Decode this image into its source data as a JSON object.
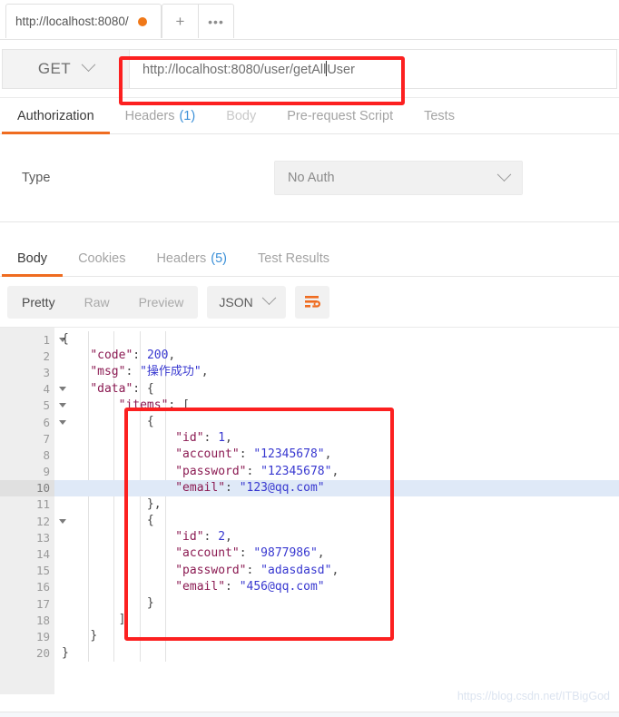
{
  "tabstrip": {
    "request_tab_title": "http://localhost:8080/",
    "unsaved_dot": "unsaved-dot",
    "new_tab_label": "+",
    "more_label": "•••"
  },
  "url_row": {
    "method": "GET",
    "url_before_caret": "http://localhost:8080/user/getAll",
    "url_after_caret": "User",
    "full_url": "http://localhost:8080/user/getAllUser"
  },
  "request_tabs": [
    {
      "label": "Authorization",
      "count": "",
      "active": true,
      "dim": false
    },
    {
      "label": "Headers",
      "count": "(1)",
      "active": false,
      "dim": false
    },
    {
      "label": "Body",
      "count": "",
      "active": false,
      "dim": true
    },
    {
      "label": "Pre-request Script",
      "count": "",
      "active": false,
      "dim": false
    },
    {
      "label": "Tests",
      "count": "",
      "active": false,
      "dim": false
    }
  ],
  "authorization": {
    "type_label": "Type",
    "selected_type": "No Auth"
  },
  "response_tabs": [
    {
      "label": "Body",
      "count": "",
      "active": true,
      "dim": false
    },
    {
      "label": "Cookies",
      "count": "",
      "active": false,
      "dim": false
    },
    {
      "label": "Headers",
      "count": "(5)",
      "active": false,
      "dim": false
    },
    {
      "label": "Test Results",
      "count": "",
      "active": false,
      "dim": false
    }
  ],
  "format_bar": {
    "views": [
      {
        "label": "Pretty",
        "active": true
      },
      {
        "label": "Raw",
        "active": false
      },
      {
        "label": "Preview",
        "active": false
      }
    ],
    "language": "JSON",
    "wrap_icon": "wrap-text-icon"
  },
  "response_body": {
    "highlighted_line": 10,
    "lines": [
      {
        "num": 1,
        "fold": true,
        "indent": 0,
        "tokens": [
          {
            "t": "p",
            "v": "{"
          }
        ]
      },
      {
        "num": 2,
        "fold": false,
        "indent": 1,
        "tokens": [
          {
            "t": "k",
            "v": "\"code\""
          },
          {
            "t": "p",
            "v": ": "
          },
          {
            "t": "n",
            "v": "200"
          },
          {
            "t": "p",
            "v": ","
          }
        ]
      },
      {
        "num": 3,
        "fold": false,
        "indent": 1,
        "tokens": [
          {
            "t": "k",
            "v": "\"msg\""
          },
          {
            "t": "p",
            "v": ": "
          },
          {
            "t": "s",
            "v": "\"操作成功\""
          },
          {
            "t": "p",
            "v": ","
          }
        ]
      },
      {
        "num": 4,
        "fold": true,
        "indent": 1,
        "tokens": [
          {
            "t": "k",
            "v": "\"data\""
          },
          {
            "t": "p",
            "v": ": {"
          }
        ]
      },
      {
        "num": 5,
        "fold": true,
        "indent": 2,
        "tokens": [
          {
            "t": "k",
            "v": "\"items\""
          },
          {
            "t": "p",
            "v": ": ["
          }
        ]
      },
      {
        "num": 6,
        "fold": true,
        "indent": 3,
        "tokens": [
          {
            "t": "p",
            "v": "{"
          }
        ]
      },
      {
        "num": 7,
        "fold": false,
        "indent": 4,
        "tokens": [
          {
            "t": "k",
            "v": "\"id\""
          },
          {
            "t": "p",
            "v": ": "
          },
          {
            "t": "n",
            "v": "1"
          },
          {
            "t": "p",
            "v": ","
          }
        ]
      },
      {
        "num": 8,
        "fold": false,
        "indent": 4,
        "tokens": [
          {
            "t": "k",
            "v": "\"account\""
          },
          {
            "t": "p",
            "v": ": "
          },
          {
            "t": "s",
            "v": "\"12345678\""
          },
          {
            "t": "p",
            "v": ","
          }
        ]
      },
      {
        "num": 9,
        "fold": false,
        "indent": 4,
        "tokens": [
          {
            "t": "k",
            "v": "\"password\""
          },
          {
            "t": "p",
            "v": ": "
          },
          {
            "t": "s",
            "v": "\"12345678\""
          },
          {
            "t": "p",
            "v": ","
          }
        ]
      },
      {
        "num": 10,
        "fold": false,
        "indent": 4,
        "tokens": [
          {
            "t": "k",
            "v": "\"email\""
          },
          {
            "t": "p",
            "v": ": "
          },
          {
            "t": "s",
            "v": "\"123@qq.com\""
          }
        ]
      },
      {
        "num": 11,
        "fold": false,
        "indent": 3,
        "tokens": [
          {
            "t": "p",
            "v": "},"
          }
        ]
      },
      {
        "num": 12,
        "fold": true,
        "indent": 3,
        "tokens": [
          {
            "t": "p",
            "v": "{"
          }
        ]
      },
      {
        "num": 13,
        "fold": false,
        "indent": 4,
        "tokens": [
          {
            "t": "k",
            "v": "\"id\""
          },
          {
            "t": "p",
            "v": ": "
          },
          {
            "t": "n",
            "v": "2"
          },
          {
            "t": "p",
            "v": ","
          }
        ]
      },
      {
        "num": 14,
        "fold": false,
        "indent": 4,
        "tokens": [
          {
            "t": "k",
            "v": "\"account\""
          },
          {
            "t": "p",
            "v": ": "
          },
          {
            "t": "s",
            "v": "\"9877986\""
          },
          {
            "t": "p",
            "v": ","
          }
        ]
      },
      {
        "num": 15,
        "fold": false,
        "indent": 4,
        "tokens": [
          {
            "t": "k",
            "v": "\"password\""
          },
          {
            "t": "p",
            "v": ": "
          },
          {
            "t": "s",
            "v": "\"adasdasd\""
          },
          {
            "t": "p",
            "v": ","
          }
        ]
      },
      {
        "num": 16,
        "fold": false,
        "indent": 4,
        "tokens": [
          {
            "t": "k",
            "v": "\"email\""
          },
          {
            "t": "p",
            "v": ": "
          },
          {
            "t": "s",
            "v": "\"456@qq.com\""
          }
        ]
      },
      {
        "num": 17,
        "fold": false,
        "indent": 3,
        "tokens": [
          {
            "t": "p",
            "v": "}"
          }
        ]
      },
      {
        "num": 18,
        "fold": false,
        "indent": 2,
        "tokens": [
          {
            "t": "p",
            "v": "]"
          }
        ]
      },
      {
        "num": 19,
        "fold": false,
        "indent": 1,
        "tokens": [
          {
            "t": "p",
            "v": "}"
          }
        ]
      },
      {
        "num": 20,
        "fold": false,
        "indent": 0,
        "tokens": [
          {
            "t": "p",
            "v": "}"
          }
        ]
      }
    ]
  },
  "annotations": [
    {
      "name": "url-highlight-box",
      "color": "#fc2020"
    },
    {
      "name": "json-items-highlight-box",
      "color": "#fc2020"
    }
  ],
  "watermark": "https://blog.csdn.net/ITBigGod",
  "colors": {
    "accent_orange": "#ef6c20",
    "unsaved_dot": "#f07818",
    "annotation_red": "#fc2020",
    "json_key": "#8b1a52",
    "json_value": "#3838d0",
    "count_blue": "#3b90d8",
    "active_line": "#dfe9f7"
  }
}
